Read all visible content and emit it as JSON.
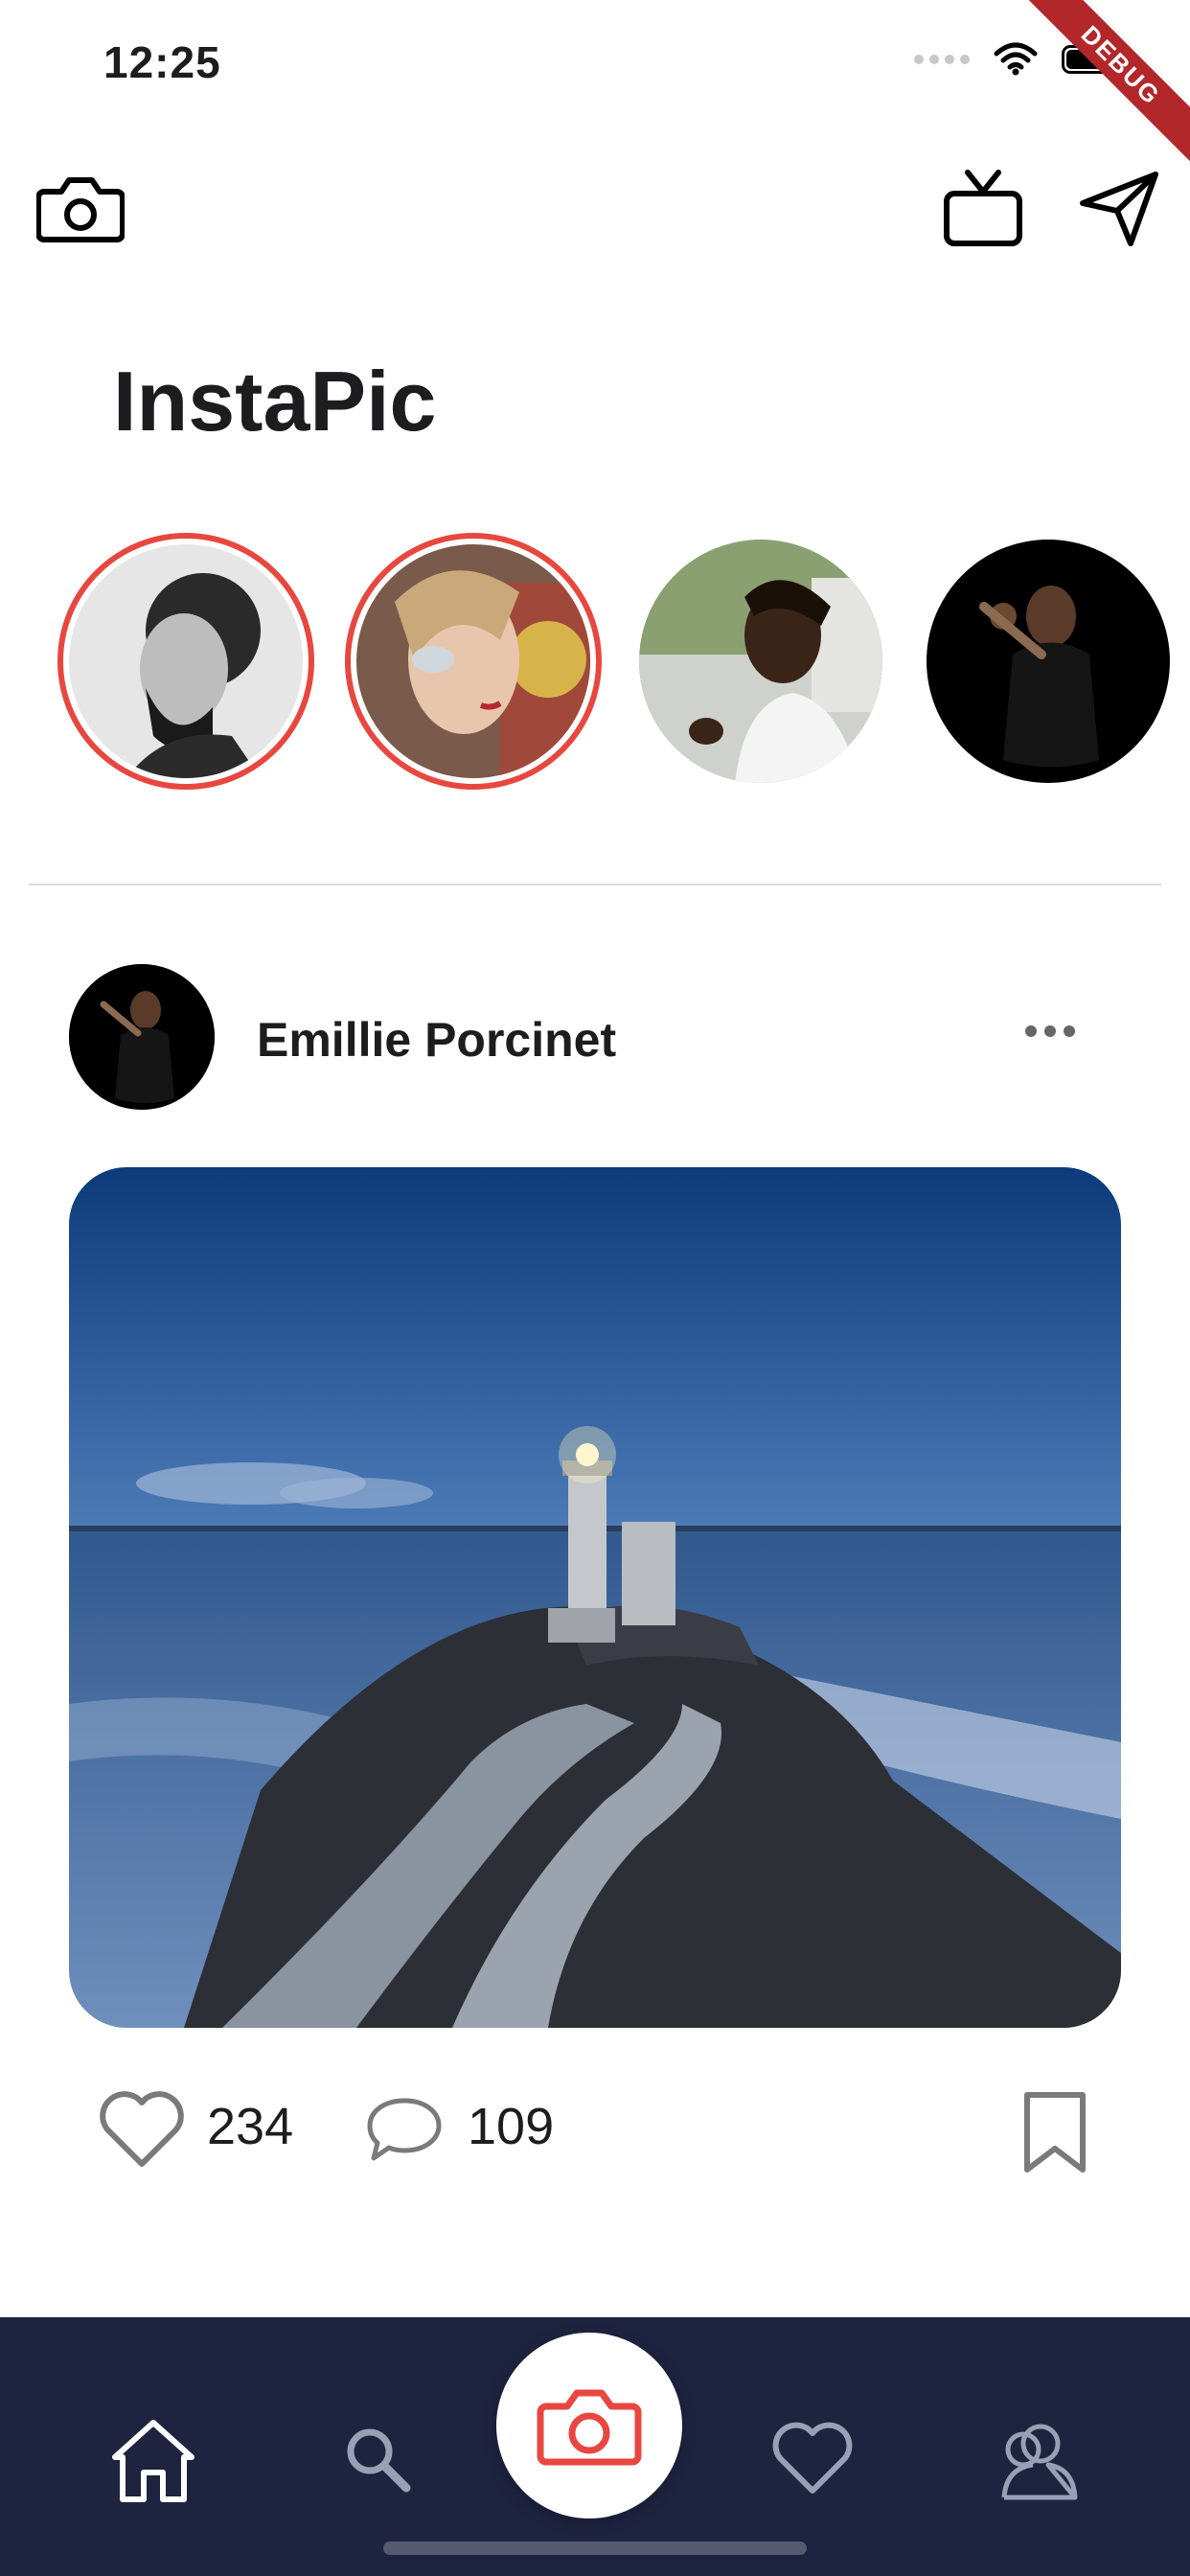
{
  "status_bar": {
    "time": "12:25"
  },
  "debug_badge": "DEBUG",
  "header": {
    "title": "InstaPic"
  },
  "stories": [
    {
      "name": "story-1",
      "has_ring": true
    },
    {
      "name": "story-2",
      "has_ring": true
    },
    {
      "name": "story-3",
      "has_ring": false
    },
    {
      "name": "story-4",
      "has_ring": false
    }
  ],
  "post": {
    "username": "Emillie Porcinet",
    "likes": "234",
    "comments": "109"
  },
  "icons": {
    "top_left": "camera-icon",
    "top_right": [
      "tv-icon",
      "send-icon"
    ],
    "nav": [
      "home-icon",
      "search-icon",
      "camera-icon",
      "heart-icon",
      "profile-icon"
    ]
  },
  "colors": {
    "accent": "#e8473f",
    "nav_background": "#1e2340"
  }
}
